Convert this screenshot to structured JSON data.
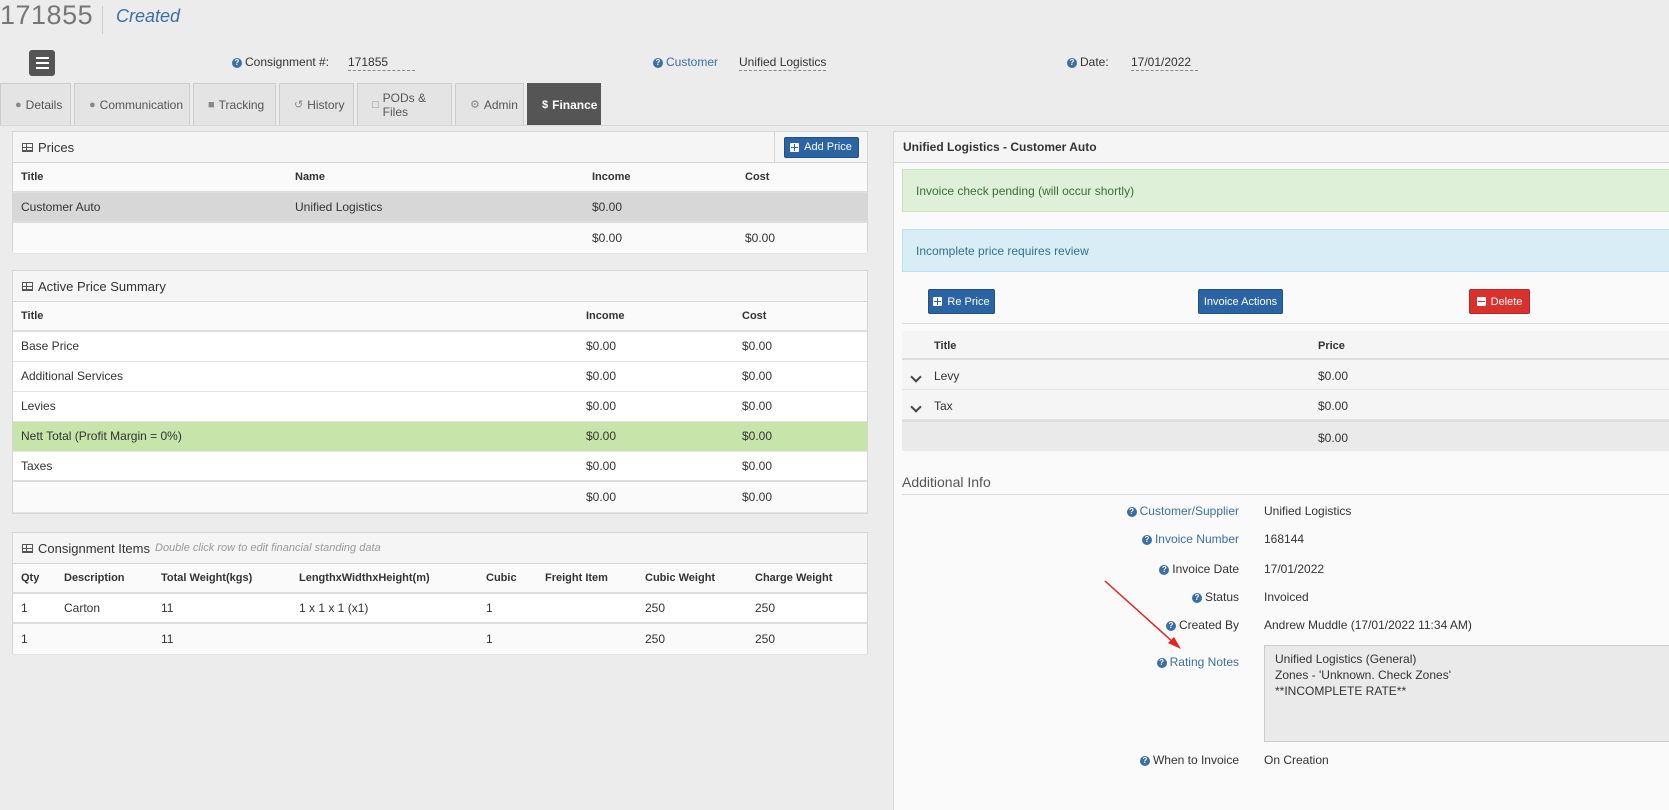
{
  "header": {
    "number": "171855",
    "status": "Created"
  },
  "fields": {
    "consignment_label": "Consignment #:",
    "consignment_value": "171855",
    "customer_label": "Customer",
    "customer_value": "Unified Logistics",
    "date_label": "Date:",
    "date_value": "17/01/2022"
  },
  "tabs": [
    {
      "label": "Details",
      "icon": "user-icon"
    },
    {
      "label": "Communication",
      "icon": "comment-icon"
    },
    {
      "label": "Tracking",
      "icon": "truck-icon"
    },
    {
      "label": "History",
      "icon": "history-icon"
    },
    {
      "label": "PODs & Files",
      "icon": "file-icon"
    },
    {
      "label": "Admin",
      "icon": "gear-icon"
    },
    {
      "label": "Finance",
      "icon": "dollar-icon"
    }
  ],
  "prices": {
    "title": "Prices",
    "add_button": "Add Price",
    "columns": [
      "Title",
      "Name",
      "Income",
      "Cost"
    ],
    "rows": [
      [
        "Customer Auto",
        "Unified Logistics",
        "$0.00",
        ""
      ]
    ],
    "total": [
      "",
      "",
      "$0.00",
      "$0.00"
    ]
  },
  "summary": {
    "title": "Active Price Summary",
    "columns": [
      "Title",
      "Income",
      "Cost"
    ],
    "rows": [
      [
        "Base Price",
        "$0.00",
        "$0.00"
      ],
      [
        "Additional Services",
        "$0.00",
        "$0.00"
      ],
      [
        "Levies",
        "$0.00",
        "$0.00"
      ],
      [
        "Nett Total (Profit Margin = 0%)",
        "$0.00",
        "$0.00"
      ],
      [
        "Taxes",
        "$0.00",
        "$0.00"
      ]
    ],
    "total": [
      "",
      "$0.00",
      "$0.00"
    ]
  },
  "items": {
    "title": "Consignment Items",
    "subtitle": "Double click row to edit financial standing data",
    "columns": [
      "Qty",
      "Description",
      "Total Weight(kgs)",
      "LengthxWidthxHeight(m)",
      "Cubic",
      "Freight Item",
      "Cubic Weight",
      "Charge Weight"
    ],
    "rows": [
      [
        "1",
        "Carton",
        "11",
        "1 x 1 x 1 (x1)",
        "1",
        "",
        "250",
        "250"
      ]
    ],
    "total": [
      "1",
      "",
      "11",
      "",
      "1",
      "",
      "250",
      "250"
    ]
  },
  "right": {
    "title": "Unified Logistics - Customer Auto",
    "alert_success": "Invoice check pending (will occur shortly)",
    "alert_info": "Incomplete price requires review",
    "reprice_button": "Re Price",
    "invoice_actions_button": "Invoice Actions",
    "delete_button": "Delete",
    "columns": [
      "Title",
      "Price"
    ],
    "rows": [
      [
        "Levy",
        "$0.00"
      ],
      [
        "Tax",
        "$0.00"
      ]
    ],
    "total": "$0.00",
    "additional_title": "Additional Info",
    "info": [
      {
        "label": "Customer/Supplier",
        "value": "Unified Logistics"
      },
      {
        "label": "Invoice Number",
        "value": "168144"
      },
      {
        "label": "Invoice Date",
        "value": "17/01/2022"
      },
      {
        "label": "Status",
        "value": "Invoiced"
      },
      {
        "label": "Created By",
        "value": "Andrew Muddle (17/01/2022 11:34 AM)"
      },
      {
        "label": "Rating Notes",
        "value": ""
      },
      {
        "label": "When to Invoice",
        "value": "On Creation"
      }
    ],
    "rating_notes": [
      "Unified Logistics (General)",
      "Zones - 'Unknown. Check Zones'",
      "**INCOMPLETE RATE**"
    ]
  },
  "colors": {
    "accent": "#2a64a3",
    "danger": "#d9322e",
    "success_row": "#c7e4ab",
    "annotation_arrow": "#e8231f"
  }
}
